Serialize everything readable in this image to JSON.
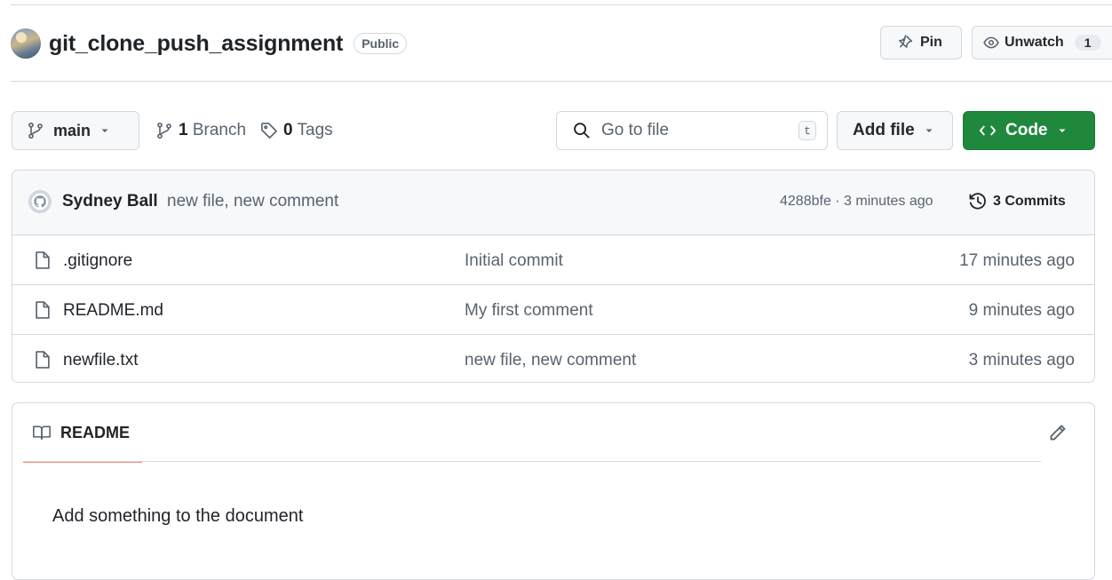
{
  "repo": {
    "name": "git_clone_push_assignment",
    "visibility": "Public"
  },
  "header_actions": {
    "pin_label": "Pin",
    "unwatch_label": "Unwatch",
    "watch_count": "1"
  },
  "toolbar": {
    "branch_name": "main",
    "branch_count": "1",
    "branch_label": "Branch",
    "tag_count": "0",
    "tag_label": "Tags",
    "search_placeholder": "Go to file",
    "search_shortcut": "t",
    "add_file_label": "Add file",
    "code_label": "Code"
  },
  "latest_commit": {
    "author": "Sydney Ball",
    "message": "new file, new comment",
    "meta": "4288bfe · 3 minutes ago",
    "commits_label": "3 Commits"
  },
  "files": [
    {
      "name": ".gitignore",
      "commit": "Initial commit",
      "age": "17 minutes ago"
    },
    {
      "name": "README.md",
      "commit": "My first comment",
      "age": "9 minutes ago"
    },
    {
      "name": "newfile.txt",
      "commit": "new file, new comment",
      "age": "3 minutes ago"
    }
  ],
  "readme": {
    "tab_label": "README",
    "content": "Add something to the document"
  },
  "colors": {
    "primary_button": "#1f883d",
    "border": "#d1d9e0",
    "muted_text": "#59636e",
    "active_tab_underline": "#fd8c73"
  },
  "icons": [
    "repo-owner-avatar",
    "pin-icon",
    "eye-icon",
    "git-branch-icon",
    "tag-icon",
    "search-icon",
    "triangle-down-icon",
    "code-icon",
    "history-icon",
    "file-icon",
    "book-icon",
    "pencil-icon"
  ]
}
